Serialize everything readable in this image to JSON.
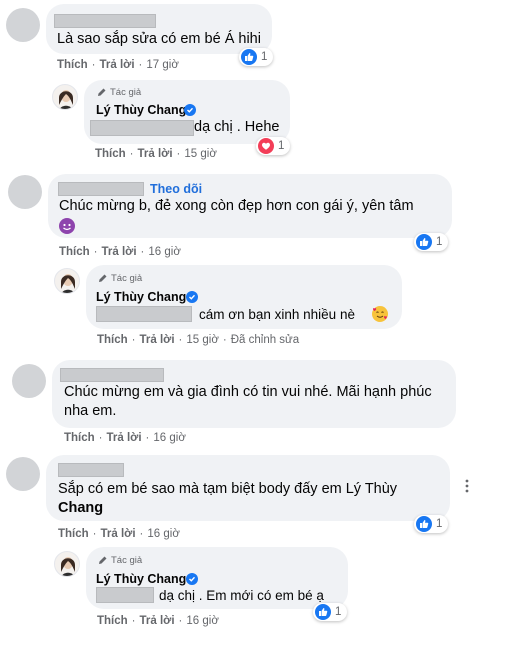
{
  "comments": [
    {
      "text": "Là sao sắp sửa có em bé Á hihi",
      "actions": {
        "like": "Thích",
        "reply": "Trả lời",
        "time": "17 giờ"
      },
      "reaction": {
        "type": "like",
        "count": "1"
      },
      "reply": {
        "author_tag": "Tác giả",
        "name": "Lý Thùy Chang",
        "text": "dạ chị . Hehe",
        "actions": {
          "like": "Thích",
          "reply": "Trả lời",
          "time": "15 giờ"
        },
        "reaction": {
          "type": "love",
          "count": "1"
        }
      }
    },
    {
      "follow": "Theo dõi",
      "text_line1": "Chúc mừng b, đẻ xong còn đẹp hơn con gái ý, yên tâm",
      "emoji": "smiling-face-with-horns-emoji",
      "actions": {
        "like": "Thích",
        "reply": "Trả lời",
        "time": "16 giờ"
      },
      "reaction": {
        "type": "like",
        "count": "1"
      },
      "reply": {
        "author_tag": "Tác giả",
        "name": "Lý Thùy Chang",
        "text": "cám ơn bạn xinh nhiều nè",
        "emoji": "smiling-face-with-hearts-emoji",
        "actions": {
          "like": "Thích",
          "reply": "Trả lời",
          "time": "15 giờ",
          "edited": "Đã chỉnh sửa"
        }
      }
    },
    {
      "text_line1": "Chúc mừng em và gia đình có tin vui nhé. Mãi hạnh phúc",
      "text_line2": "nha em.",
      "actions": {
        "like": "Thích",
        "reply": "Trả lời",
        "time": "16 giờ"
      }
    },
    {
      "text_line1": "Sắp có em bé sao mà tạm biệt body đấy em Lý Thùy",
      "text_line2": "Chang",
      "actions": {
        "like": "Thích",
        "reply": "Trả lời",
        "time": "16 giờ"
      },
      "reaction": {
        "type": "like",
        "count": "1"
      },
      "reply": {
        "author_tag": "Tác giả",
        "name": "Lý Thùy Chang",
        "text": "dạ chị . Em mới có em bé ạ",
        "actions": {
          "like": "Thích",
          "reply": "Trả lời",
          "time": "16 giờ"
        },
        "reaction": {
          "type": "like",
          "count": "1"
        }
      }
    }
  ],
  "colors": {
    "like": "#1877f2",
    "love": "#f33e58",
    "bubble": "#f0f2f5",
    "link": "#216fdb"
  }
}
